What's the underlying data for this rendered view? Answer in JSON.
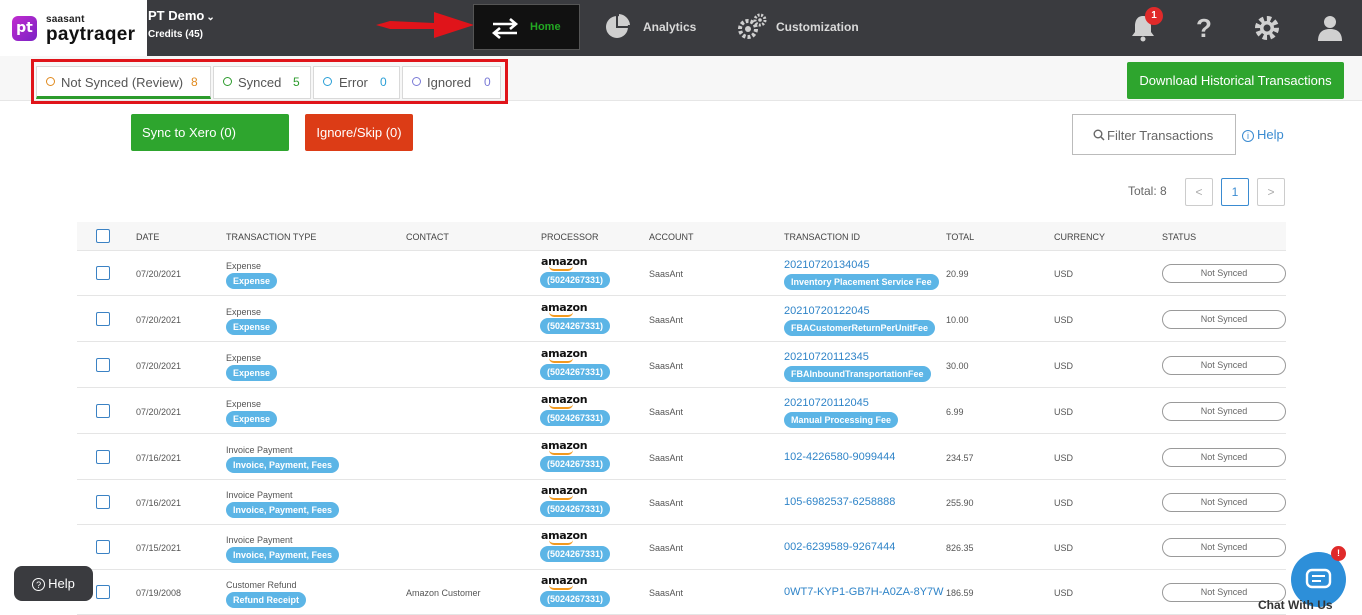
{
  "app": {
    "logo_small": "saasant",
    "logo_big": "paytraqer",
    "logo_mark": "pt",
    "company": "PT Demo",
    "credits": "Credits (45)"
  },
  "nav": {
    "home": "Home",
    "analytics": "Analytics",
    "customization": "Customization",
    "notification_count": "1",
    "help_glyph": "?"
  },
  "tabs": [
    {
      "label": "Not Synced (Review)",
      "count": "8",
      "color": "#e08a1e"
    },
    {
      "label": "Synced",
      "count": "5",
      "color": "#2c9b2c"
    },
    {
      "label": "Error",
      "count": "0",
      "color": "#2a9fd6"
    },
    {
      "label": "Ignored",
      "count": "0",
      "color": "#7a7ad6"
    }
  ],
  "actions": {
    "download": "Download Historical Transactions",
    "sync": "Sync to Xero  (0)",
    "ignore": "Ignore/Skip (0)",
    "filter": "Filter Transactions",
    "help": "Help",
    "help_glyph": "i"
  },
  "pagination": {
    "total": "Total: 8",
    "prev": "<",
    "page": "1",
    "next": ">"
  },
  "table": {
    "headers": [
      "DATE",
      "TRANSACTION TYPE",
      "CONTACT",
      "PROCESSOR",
      "ACCOUNT",
      "TRANSACTION ID",
      "TOTAL",
      "CURRENCY",
      "STATUS"
    ],
    "rows": [
      {
        "date": "07/20/2021",
        "type": "Expense",
        "type_tag": "Expense",
        "contact": "",
        "processor": "amazon",
        "processor_id": "(5024267331)",
        "account": "SaasAnt",
        "txn_id": "20210720134045",
        "txn_tag": "Inventory Placement Service Fee",
        "total": "20.99",
        "currency": "USD",
        "status": "Not Synced"
      },
      {
        "date": "07/20/2021",
        "type": "Expense",
        "type_tag": "Expense",
        "contact": "",
        "processor": "amazon",
        "processor_id": "(5024267331)",
        "account": "SaasAnt",
        "txn_id": "20210720122045",
        "txn_tag": "FBACustomerReturnPerUnitFee",
        "total": "10.00",
        "currency": "USD",
        "status": "Not Synced"
      },
      {
        "date": "07/20/2021",
        "type": "Expense",
        "type_tag": "Expense",
        "contact": "",
        "processor": "amazon",
        "processor_id": "(5024267331)",
        "account": "SaasAnt",
        "txn_id": "20210720112345",
        "txn_tag": "FBAInboundTransportationFee",
        "total": "30.00",
        "currency": "USD",
        "status": "Not Synced"
      },
      {
        "date": "07/20/2021",
        "type": "Expense",
        "type_tag": "Expense",
        "contact": "",
        "processor": "amazon",
        "processor_id": "(5024267331)",
        "account": "SaasAnt",
        "txn_id": "20210720112045",
        "txn_tag": "Manual Processing Fee",
        "total": "6.99",
        "currency": "USD",
        "status": "Not Synced"
      },
      {
        "date": "07/16/2021",
        "type": "Invoice Payment",
        "type_tag": "Invoice, Payment, Fees",
        "contact": "",
        "processor": "amazon",
        "processor_id": "(5024267331)",
        "account": "SaasAnt",
        "txn_id": "102-4226580-9099444",
        "txn_tag": "",
        "total": "234.57",
        "currency": "USD",
        "status": "Not Synced"
      },
      {
        "date": "07/16/2021",
        "type": "Invoice Payment",
        "type_tag": "Invoice, Payment, Fees",
        "contact": "",
        "processor": "amazon",
        "processor_id": "(5024267331)",
        "account": "SaasAnt",
        "txn_id": "105-6982537-6258888",
        "txn_tag": "",
        "total": "255.90",
        "currency": "USD",
        "status": "Not Synced"
      },
      {
        "date": "07/15/2021",
        "type": "Invoice Payment",
        "type_tag": "Invoice, Payment, Fees",
        "contact": "",
        "processor": "amazon",
        "processor_id": "(5024267331)",
        "account": "SaasAnt",
        "txn_id": "002-6239589-9267444",
        "txn_tag": "",
        "total": "826.35",
        "currency": "USD",
        "status": "Not Synced"
      },
      {
        "date": "07/19/2008",
        "type": "Customer Refund",
        "type_tag": "Refund Receipt",
        "contact": "Amazon Customer",
        "processor": "amazon",
        "processor_id": "(5024267331)",
        "account": "SaasAnt",
        "txn_id": "0WT7-KYP1-GB7H-A0ZA-8Y7W",
        "txn_tag": "",
        "total": "186.59",
        "currency": "USD",
        "status": "Not Synced"
      }
    ]
  },
  "floating": {
    "help": "Help",
    "help_glyph": "?",
    "chat": "Chat With Us",
    "chat_badge": "!"
  },
  "colors": {
    "topbar": "#3a3b3f",
    "accent_green": "#2ea52e",
    "danger": "#dc3c16",
    "link_blue": "#2f84c8",
    "tag_blue": "#5cb5e6",
    "highlight_red": "#e0141a"
  }
}
